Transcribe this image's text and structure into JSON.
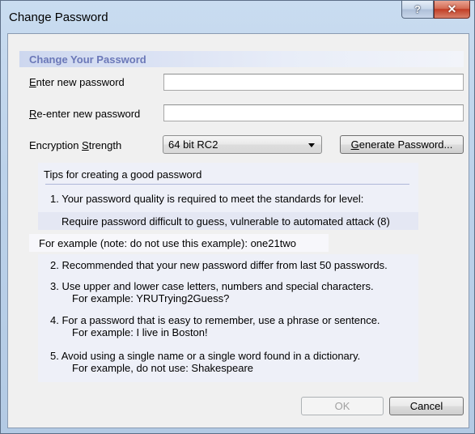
{
  "window": {
    "title": "Change Password",
    "help_glyph": "?",
    "close_glyph": "✕"
  },
  "section_header": "Change Your Password",
  "form": {
    "new_password_label_access": "E",
    "new_password_label_rest": "nter new password",
    "new_password_value": "",
    "reenter_label_access": "R",
    "reenter_label_rest": "e-enter new password",
    "reenter_value": "",
    "strength_label_prefix": "Encryption ",
    "strength_label_access": "S",
    "strength_label_rest": "trength",
    "strength_selected": "64 bit RC2",
    "generate_access": "G",
    "generate_rest": "enerate Password..."
  },
  "tips": {
    "heading": "Tips for creating a good password",
    "tip1": "1.  Your password quality is required to meet the standards for level:",
    "tip1_level": "Require password difficult to guess, vulnerable to automated attack (8)",
    "example_line": "For example (note: do not use this example):  one21two",
    "tip2": "2.  Recommended that your new password differ from last 50 passwords.",
    "tip3": "3.  Use upper and lower case letters, numbers and special characters.",
    "tip3_example": "For example:  YRUTrying2Guess?",
    "tip4": "4.  For a password that is easy to remember, use a phrase or sentence.",
    "tip4_example": "For example:  I live in Boston!",
    "tip5": "5.  Avoid using a single name or a single word found in a dictionary.",
    "tip5_example": "For example, do not use:  Shakespeare"
  },
  "buttons": {
    "ok": "OK",
    "cancel": "Cancel"
  },
  "colors": {
    "header_text": "#6b78b8",
    "panel_bg": "#eef0f8",
    "titlebar": "#bcd2ea",
    "close_button": "#c23e26"
  },
  "icons": {
    "help": "question-mark-icon",
    "close": "close-icon",
    "dropdown": "chevron-down-icon"
  }
}
